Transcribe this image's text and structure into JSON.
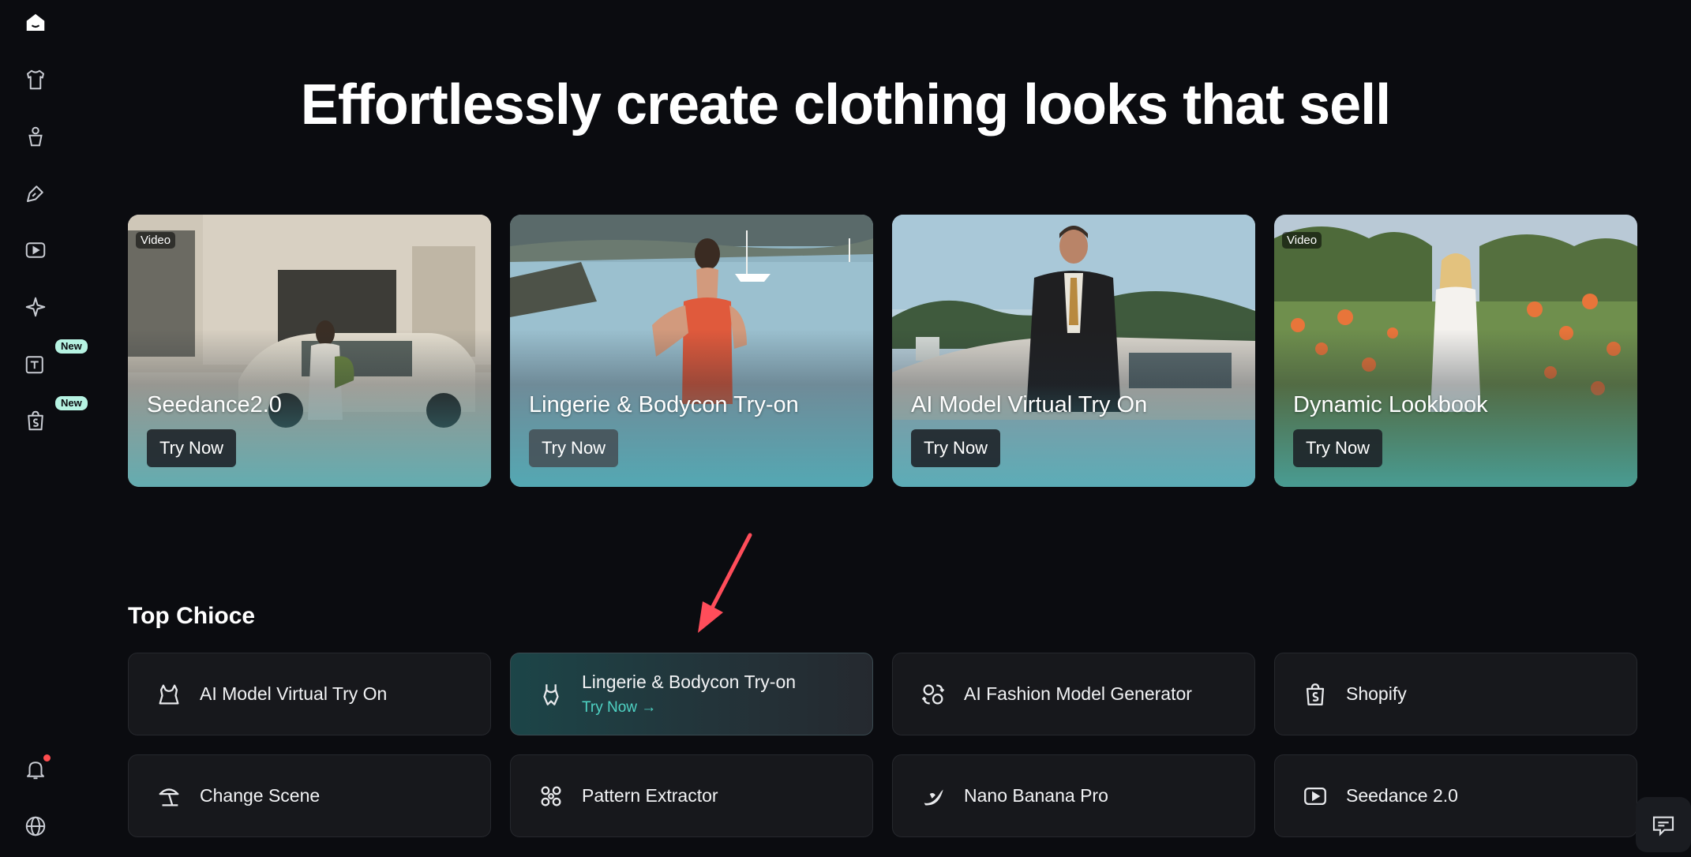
{
  "sidebar": {
    "items": [
      {
        "icon": "home-icon",
        "active": true
      },
      {
        "icon": "shirt-icon"
      },
      {
        "icon": "model-icon"
      },
      {
        "icon": "brush-icon"
      },
      {
        "icon": "video-icon"
      },
      {
        "icon": "sparkle-icon"
      },
      {
        "icon": "text-add-icon",
        "badge": "New"
      },
      {
        "icon": "shopify-bag-icon",
        "badge": "New"
      }
    ],
    "bottom": [
      {
        "icon": "bell-icon",
        "has_dot": true
      },
      {
        "icon": "globe-icon"
      }
    ]
  },
  "headline": "Effortlessly create clothing looks that sell",
  "feature_cards": [
    {
      "tag": "Video",
      "title": "Seedance2.0",
      "button": "Try Now"
    },
    {
      "tag": "",
      "title": "Lingerie & Bodycon Try-on",
      "button": "Try Now"
    },
    {
      "tag": "",
      "title": "AI Model Virtual Try On",
      "button": "Try Now"
    },
    {
      "tag": "Video",
      "title": "Dynamic Lookbook",
      "button": "Try Now"
    }
  ],
  "top_choice": {
    "title": "Top Chioce",
    "items": [
      {
        "label": "AI Model Virtual Try On",
        "icon": "tryon-icon"
      },
      {
        "label": "Lingerie & Bodycon Try-on",
        "icon": "bodysuit-icon",
        "sub": "Try Now →",
        "active": true
      },
      {
        "label": "AI Fashion Model Generator",
        "icon": "face-swap-icon"
      },
      {
        "label": "Shopify",
        "icon": "shopify-icon"
      },
      {
        "label": "Change Scene",
        "icon": "scene-icon"
      },
      {
        "label": "Pattern Extractor",
        "icon": "pattern-icon"
      },
      {
        "label": "Nano Banana Pro",
        "icon": "banana-icon"
      },
      {
        "label": "Seedance 2.0",
        "icon": "play-icon"
      }
    ]
  },
  "colors": {
    "background": "#0b0c10",
    "accent": "#4fd3c4",
    "tile": "#17181c",
    "annotation_arrow": "#ff4d5a"
  }
}
